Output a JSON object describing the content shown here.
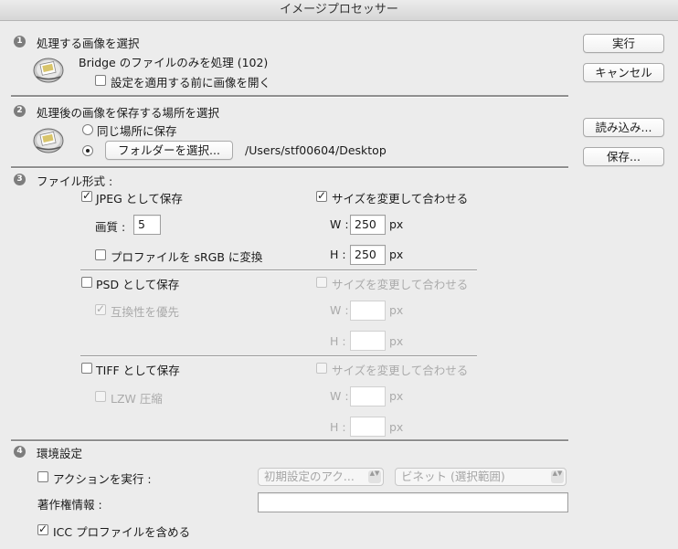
{
  "window": {
    "title": "イメージプロセッサー"
  },
  "buttons": {
    "run": "実行",
    "cancel": "キャンセル",
    "load": "読み込み...",
    "save": "保存..."
  },
  "section1": {
    "number": "1",
    "title": "処理する画像を選択",
    "source_label": "Bridge のファイルのみを処理 (102)",
    "open_first_label": "設定を適用する前に画像を開く",
    "open_first_checked": false
  },
  "section2": {
    "number": "2",
    "title": "処理後の画像を保存する場所を選択",
    "same_location_label": "同じ場所に保存",
    "select_folder_button": "フォルダーを選択...",
    "folder_path": "/Users/stf00604/Desktop",
    "selected_option": "folder"
  },
  "section3": {
    "number": "3",
    "title": "ファイル形式 :",
    "jpeg": {
      "save_label": "JPEG として保存",
      "save_checked": true,
      "quality_label": "画質 :",
      "quality_value": "5",
      "srgb_label": "プロファイルを sRGB に変換",
      "srgb_checked": false,
      "resize_label": "サイズを変更して合わせる",
      "resize_checked": true,
      "w_label": "W :",
      "w_value": "250",
      "h_label": "H :",
      "h_value": "250",
      "unit": "px"
    },
    "psd": {
      "save_label": "PSD として保存",
      "save_checked": false,
      "compat_label": "互換性を優先",
      "compat_checked": true,
      "resize_label": "サイズを変更して合わせる",
      "w_label": "W :",
      "h_label": "H :",
      "unit": "px"
    },
    "tiff": {
      "save_label": "TIFF として保存",
      "save_checked": false,
      "lzw_label": "LZW 圧縮",
      "resize_label": "サイズを変更して合わせる",
      "w_label": "W :",
      "h_label": "H :",
      "unit": "px"
    }
  },
  "section4": {
    "number": "4",
    "title": "環境設定",
    "action_label": "アクションを実行 :",
    "action_checked": false,
    "action_set": "初期設定のアク...",
    "action_name": "ビネット (選択範囲)",
    "copyright_label": "著作権情報 :",
    "copyright_value": "",
    "icc_label": "ICC プロファイルを含める",
    "icc_checked": true
  },
  "glyphs": {
    "check": "✓",
    "updown": "▲▼"
  }
}
